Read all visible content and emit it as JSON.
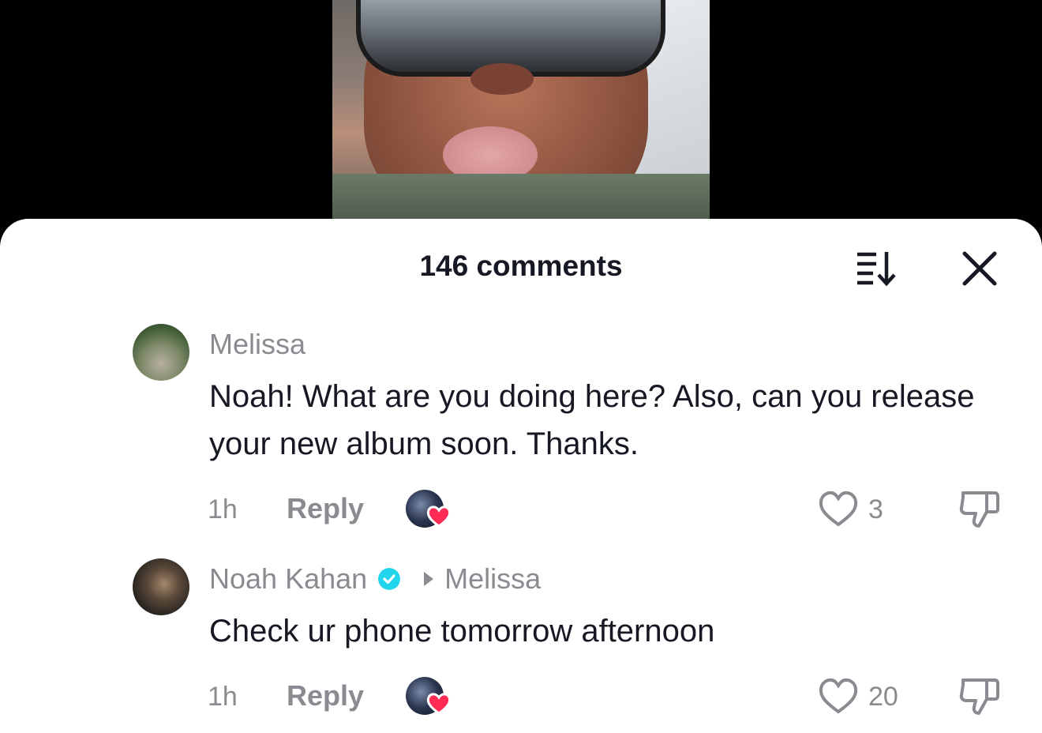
{
  "header": {
    "title": "146 comments"
  },
  "comments": [
    {
      "username": "Melissa",
      "text": "Noah! What are you doing here? Also, can you release your new album soon. Thanks.",
      "time": "1h",
      "reply_label": "Reply",
      "likes": "3"
    },
    {
      "username": "Noah Kahan",
      "reply_to": "Melissa",
      "text": "Check ur phone tomorrow afternoon",
      "time": "1h",
      "reply_label": "Reply",
      "likes": "20"
    }
  ],
  "colors": {
    "heart": "#fe2c55",
    "verified": "#20d5ec",
    "muted": "#8a8b91",
    "text": "#161823"
  },
  "icons": [
    "sort-icon",
    "close-icon",
    "heart-outline-icon",
    "dislike-icon",
    "verified-badge-icon",
    "creator-heart-icon"
  ]
}
